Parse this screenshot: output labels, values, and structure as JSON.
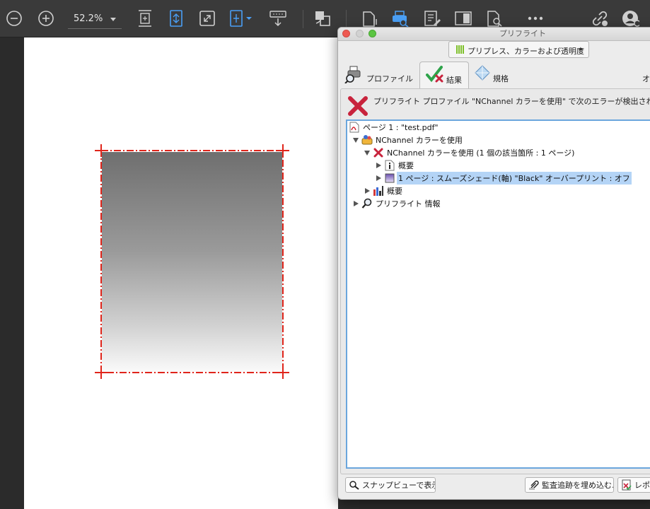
{
  "toolbar": {
    "zoom_value": "52.2%"
  },
  "preflight": {
    "window_title": "プリフライト",
    "mode_label": "プリプレス、カラーおよび透明度",
    "tabs": {
      "profiles": "プロファイル",
      "results": "結果",
      "standards": "規格",
      "more": "オ"
    },
    "error_message": "プリフライト プロファイル \"NChannel カラーを使用\" で次のエラーが検出されました",
    "tree": [
      {
        "label": "ページ 1 : \"test.pdf\""
      },
      {
        "label": "NChannel カラーを使用"
      },
      {
        "label": "NChannel カラーを使用 (1 個の該当箇所 : 1 ページ)"
      },
      {
        "label": "概要"
      },
      {
        "label": "1 ページ : スムーズシェード(軸) \"Black\" オーバープリント : オフ"
      },
      {
        "label": "概要"
      },
      {
        "label": "プリフライト 情報"
      }
    ],
    "buttons": {
      "snap_view": "スナップビューで表示",
      "embed_audit": "監査追跡を埋め込む...",
      "report": "レポー"
    }
  }
}
